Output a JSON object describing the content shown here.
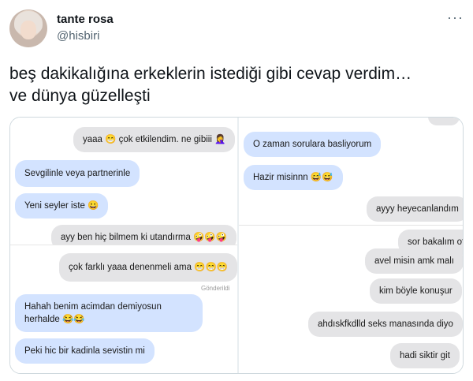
{
  "tweet": {
    "author_name": "tante rosa",
    "author_handle": "@hisbiri",
    "more_icon": "···",
    "text_line1": "beş dakikalığına erkeklerin istediği gibi cevap verdim…",
    "text_line2": "ve dünya güzelleşti"
  },
  "media": {
    "left_top": [
      "yaaa 😁 çok etkilendim. ne gibiii 🤦‍♀️",
      "Sevgilinle veya partnerinle",
      "Yeni seyler iste 😀",
      "ayy ben hiç bilmem ki utandırma 🤪🤪🤪"
    ],
    "left_bottom": [
      "çok farklı yaaa denenmeli ama 😁😁😁",
      "Gönderildi",
      "Hahah benim acimdan demiyosun herhalde 😂😂",
      "Peki hic bir kadinla sevistin mi"
    ],
    "right_top": [
      "O zaman sorulara basliyorum",
      "Hazir misinnn 😅😅",
      "ayyy heyecanlandım",
      "sor bakalım offff"
    ],
    "right_bottom": [
      "avel misin amk malı",
      "kim böyle konuşur",
      "ahdıskfkdlld seks manasında diyo",
      "hadi siktir git"
    ]
  }
}
